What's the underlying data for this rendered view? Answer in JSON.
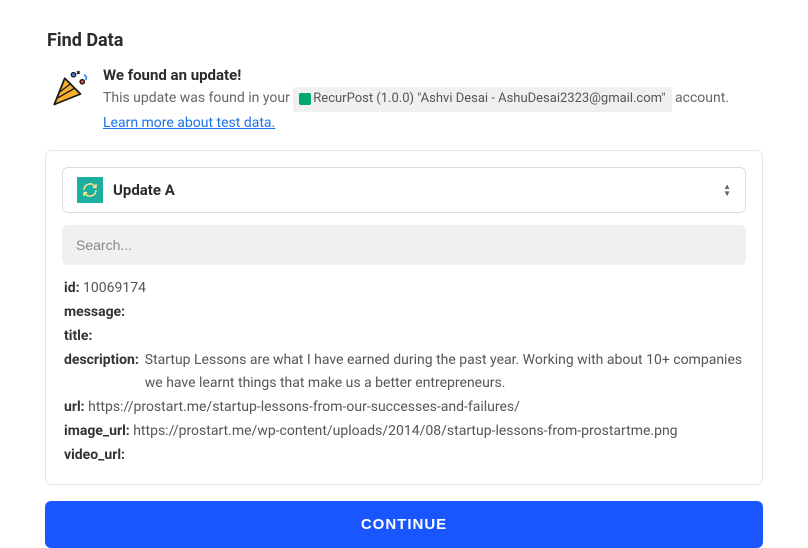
{
  "page": {
    "title": "Find Data"
  },
  "header": {
    "found_title": "We found an update!",
    "found_prefix": "This update was found in your",
    "account_label": "RecurPost (1.0.0) \"Ashvi Desai - AshuDesai2323@gmail.com\"",
    "found_suffix": "account.",
    "learn_link": "Learn more about test data."
  },
  "selector": {
    "label": "Update A"
  },
  "search": {
    "placeholder": "Search..."
  },
  "fields": {
    "id": {
      "label": "id:",
      "value": "10069174"
    },
    "message": {
      "label": "message:",
      "value": ""
    },
    "title": {
      "label": "title:",
      "value": ""
    },
    "description": {
      "label": "description:",
      "value": "Startup Lessons are what I have earned during the past year. Working with about 10+ companies we have learnt things that make us a better entrepreneurs."
    },
    "url": {
      "label": "url:",
      "value": "https://prostart.me/startup-lessons-from-our-successes-and-failures/"
    },
    "image_url": {
      "label": "image_url:",
      "value": "https://prostart.me/wp-content/uploads/2014/08/startup-lessons-from-prostartme.png"
    },
    "video_url": {
      "label": "video_url:",
      "value": ""
    }
  },
  "actions": {
    "continue": "CONTINUE"
  }
}
